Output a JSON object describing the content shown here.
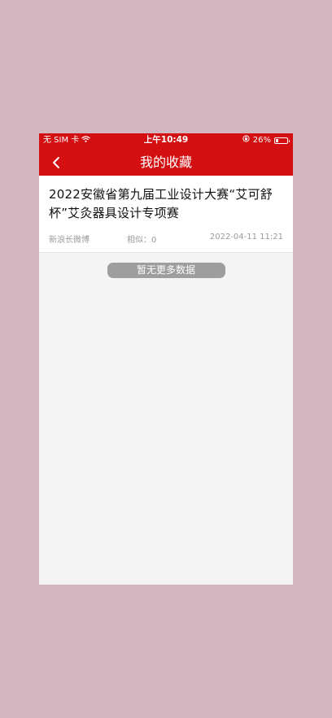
{
  "status_bar": {
    "carrier": "无 SIM 卡",
    "time": "上午10:49",
    "battery": "26%",
    "battery_level": 0.26,
    "icons": [
      "wifi-icon",
      "orientation-lock-icon",
      "battery-icon"
    ]
  },
  "header": {
    "title": "我的收藏",
    "back_icon": "chevron-left-icon",
    "color": "#d30f12"
  },
  "favorites": [
    {
      "title": "2022安徽省第九届工业设计大赛“艾可舒杯”艾灸器具设计专项赛",
      "source": "新浪长微博",
      "similar": "相似：0",
      "date": "2022-04-11 11:21"
    }
  ],
  "footer": {
    "no_more": "暂无更多数据"
  }
}
